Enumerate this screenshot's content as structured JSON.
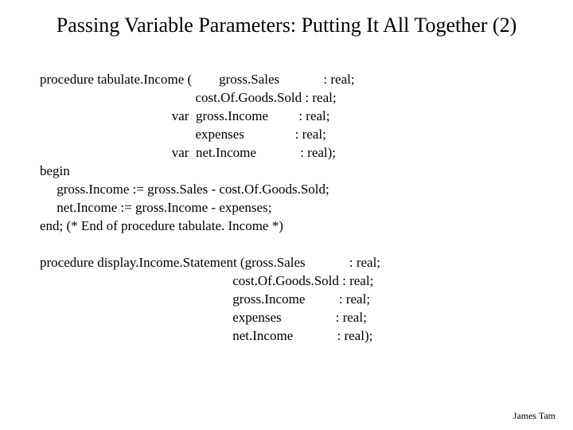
{
  "title": "Passing Variable Parameters: Putting It All Together (2)",
  "code": {
    "l1": "procedure tabulate.Income (        gross.Sales             : real;",
    "l2": "                                              cost.Of.Goods.Sold : real;",
    "l3": "                                       var  gross.Income         : real;",
    "l4": "                                              expenses               : real;",
    "l5": "                                       var  net.Income             : real);",
    "l6": "begin",
    "l7": "     gross.Income := gross.Sales - cost.Of.Goods.Sold;",
    "l8": "     net.Income := gross.Income - expenses;",
    "l9": "end; (* End of procedure tabulate. Income *)",
    "l10": "",
    "l11": "procedure display.Income.Statement (gross.Sales             : real;",
    "l12": "                                                         cost.Of.Goods.Sold : real;",
    "l13": "                                                         gross.Income          : real;",
    "l14": "                                                         expenses                : real;",
    "l15": "                                                         net.Income             : real);"
  },
  "footer": "James Tam"
}
